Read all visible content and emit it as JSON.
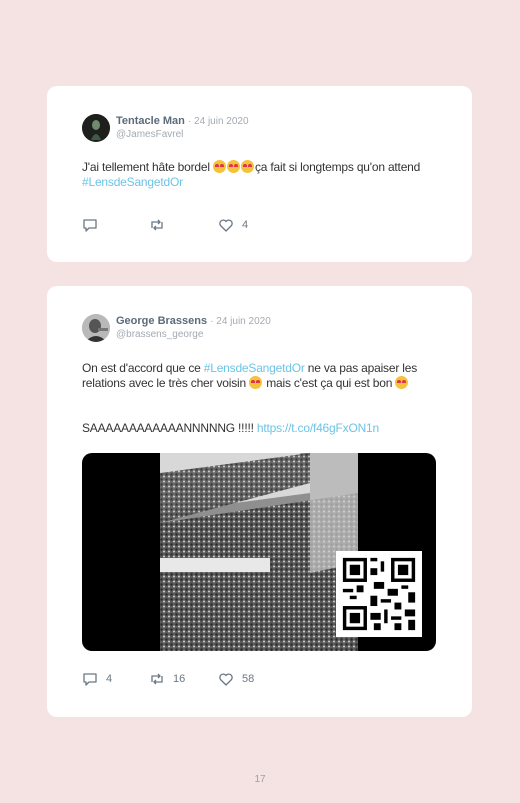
{
  "tweets": [
    {
      "author": "Tentacle Man",
      "date": "· 24 juin 2020",
      "handle": "@JamesFavrel",
      "text_before": "J'ai tellement hâte bordel ",
      "emoji": "heart-eyes-emoji",
      "text_after": "ça fait si longtemps qu'on attend ",
      "hashtag": "#LensdeSangetdOr",
      "reply_count": "",
      "retweet_count": "",
      "like_count": "4"
    },
    {
      "author": "George Brassens",
      "date": "· 24 juin 2020",
      "handle": "@brassens_george",
      "text_before": "On est d'accord que ce ",
      "hashtag": "#LensdeSangetdOr",
      "text_after": " ne va pas apaiser les relations avec le très cher voisin ",
      "text_after2": " mais c'est ça qui est bon ",
      "line2": "SAAAAAAAAAAAANNNNNG !!!!! ",
      "link": "https://t.co/f46gFxON1n",
      "reply_count": "4",
      "retweet_count": "16",
      "like_count": "58"
    }
  ],
  "page_number": "17"
}
